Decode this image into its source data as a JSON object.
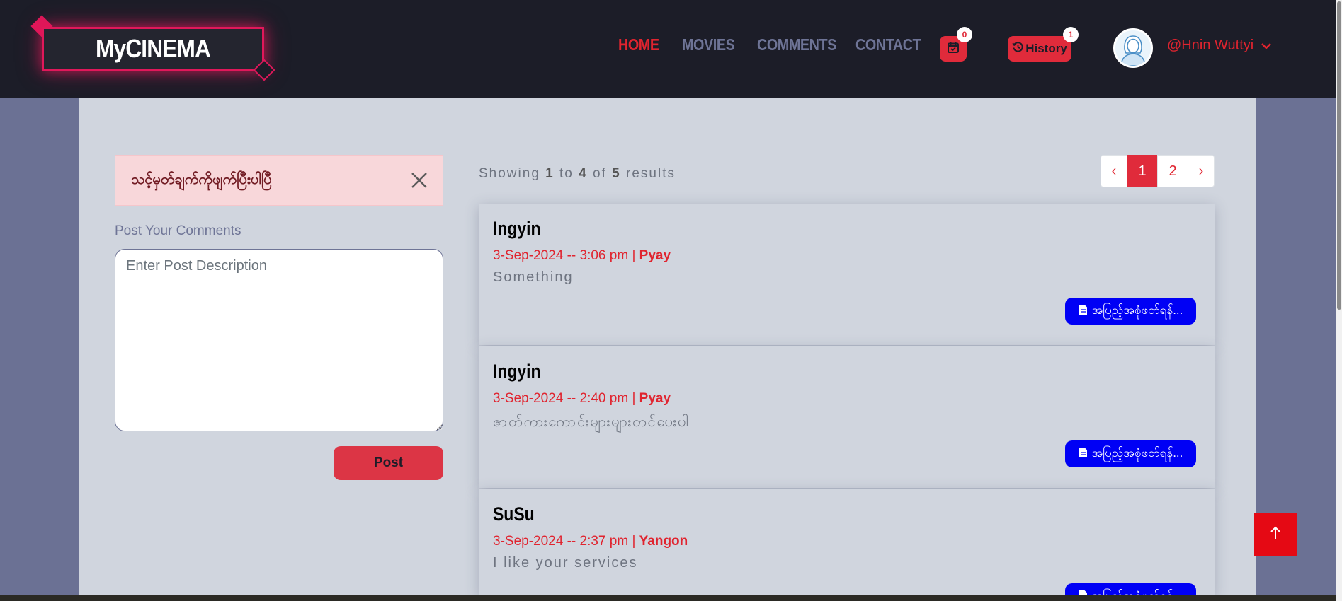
{
  "brand": {
    "logo_text": "MyCINEMA"
  },
  "nav": {
    "items": [
      {
        "label": "HOME",
        "active": true
      },
      {
        "label": "MOVIES",
        "active": false
      },
      {
        "label": "COMMENTS",
        "active": false
      },
      {
        "label": "CONTACT",
        "active": false
      }
    ]
  },
  "header": {
    "cart_count": "0",
    "history_label": "History",
    "history_count": "1",
    "username": "@Hnin Wuttyi"
  },
  "alert": {
    "message": "သင့်မှတ်ချက်ကိုဖျက်ပြီးပါပြီ"
  },
  "form": {
    "label": "Post Your Comments",
    "placeholder": "Enter Post Description",
    "submit_label": "Post"
  },
  "results": {
    "prefix": "Showing",
    "from": "1",
    "to_word": "to",
    "to": "4",
    "of_word": "of",
    "total": "5",
    "suffix": "results"
  },
  "pagination": {
    "prev": "‹",
    "pages": [
      "1",
      "2"
    ],
    "current": "1",
    "next": "›"
  },
  "comments": [
    {
      "name": "Ingyin",
      "date": "3-Sep-2024 -- 3:06 pm |",
      "city": "Pyay",
      "text": "Something",
      "button": "အပြည့်အစုံဖတ်ရန်..."
    },
    {
      "name": "Ingyin",
      "date": "3-Sep-2024 -- 2:40 pm |",
      "city": "Pyay",
      "text": "ဇာတ်ကားကောင်းများများတင်ပေးပါ",
      "button": "အပြည့်အစုံဖတ်ရန်..."
    },
    {
      "name": "SuSu",
      "date": "3-Sep-2024 -- 2:37 pm |",
      "city": "Yangon",
      "text": "I like your services",
      "button": "အပြည့်အစုံဖတ်ရန်..."
    }
  ],
  "colors": {
    "header_bg": "#1c1d28",
    "accent_red": "#e0242f",
    "page_bg": "#6b7194",
    "content_bg": "#d0d5de",
    "read_more_bg": "#0000f5"
  },
  "icons": {
    "cart": "calendar-check-icon",
    "history": "history-icon",
    "dropdown": "chevron-down-icon",
    "close": "close-icon",
    "read_more": "file-icon",
    "scroll_top": "arrow-up-icon"
  }
}
